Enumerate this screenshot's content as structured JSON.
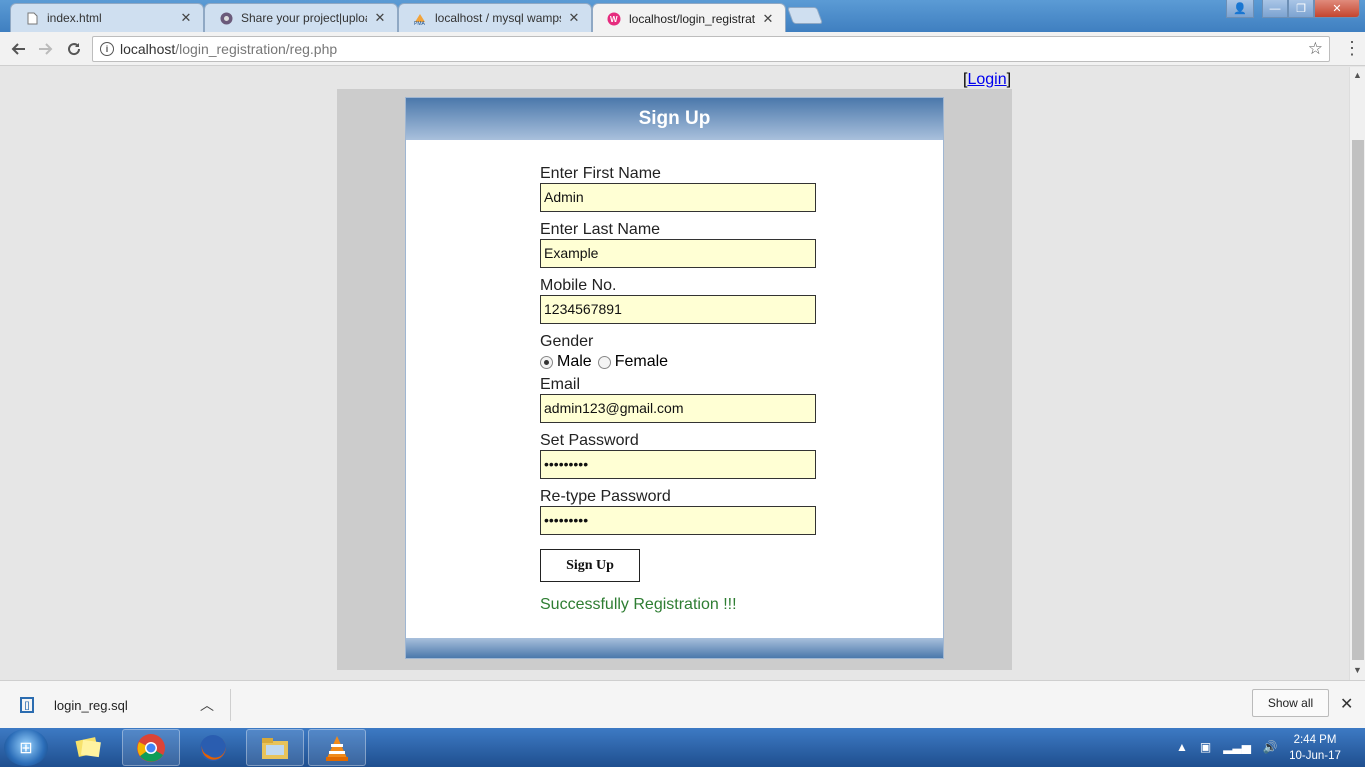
{
  "browser": {
    "tabs": [
      {
        "title": "index.html",
        "icon": "file-icon"
      },
      {
        "title": "Share your project|uploa",
        "icon": "site-favicon-icon"
      },
      {
        "title": "localhost / mysql wamps",
        "icon": "phpmyadmin-icon"
      },
      {
        "title": "localhost/login_registrati",
        "icon": "wamp-icon"
      }
    ],
    "url_host": "localhost",
    "url_path": "/login_registration/reg.php"
  },
  "page": {
    "login_bracket_open": "[",
    "login_link": "Login",
    "login_bracket_close": "]",
    "header_title": "Sign Up",
    "form": {
      "first_name_label": "Enter First Name",
      "first_name_value": "Admin",
      "last_name_label": "Enter Last Name",
      "last_name_value": "Example",
      "mobile_label": "Mobile No.",
      "mobile_value": "1234567891",
      "gender_label": "Gender",
      "gender_male": "Male",
      "gender_female": "Female",
      "email_label": "Email",
      "email_value": "admin123@gmail.com",
      "password_label": "Set Password",
      "password_value": "•••••••••",
      "retype_label": "Re-type Password",
      "retype_value": "•••••••••",
      "submit_label": "Sign Up",
      "success_message": "Successfully Registration !!!"
    },
    "selected_gender": "Male"
  },
  "download_shelf": {
    "file_name": "login_reg.sql",
    "show_all_label": "Show all"
  },
  "taskbar": {
    "time": "2:44 PM",
    "date": "10-Jun-17"
  },
  "colors": {
    "header_gradient_top": "#4b78ab",
    "input_background": "#ffffd4",
    "success_text": "#2e7d32",
    "link": "#0000ee"
  }
}
